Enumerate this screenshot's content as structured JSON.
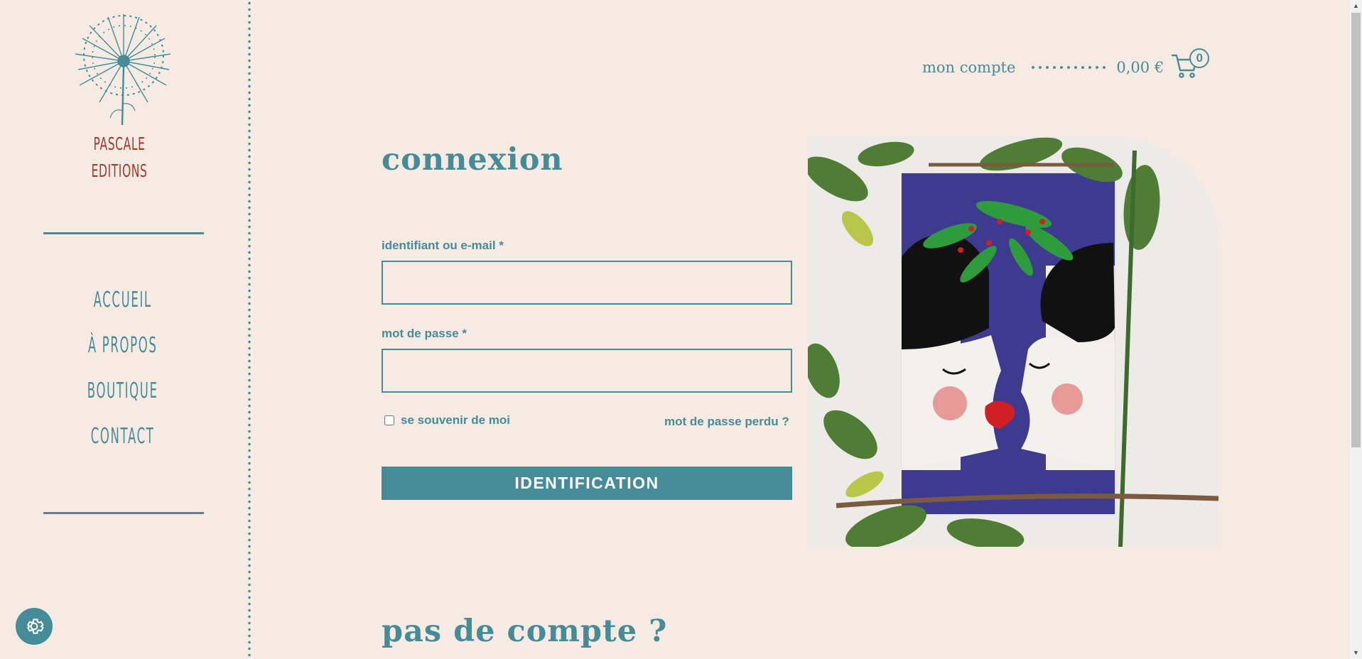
{
  "brand": {
    "line1": "PASCALE",
    "line2": "EDITIONS"
  },
  "nav": {
    "items": [
      {
        "label": "ACCUEIL"
      },
      {
        "label": "À PROPOS"
      },
      {
        "label": "BOUTIQUE"
      },
      {
        "label": "CONTACT"
      }
    ]
  },
  "header": {
    "account_label": "mon compte",
    "cart_total": "0,00 €",
    "cart_count": "0"
  },
  "login": {
    "title": "connexion",
    "username_label": "identifiant ou e-mail *",
    "username_value": "",
    "password_label": "mot de passe *",
    "password_value": "",
    "remember_label": "se souvenir de moi",
    "remember_checked": false,
    "lost_password_label": "mot de passe perdu ?",
    "submit_label": "IDENTIFICATION"
  },
  "register": {
    "title": "pas de compte ?"
  },
  "icons": {
    "logo": "dandelion-logo-icon",
    "cart": "shopping-cart-icon",
    "settings": "gear-icon"
  },
  "colors": {
    "background": "#f5ebe3",
    "accent": "#468c98",
    "brand": "#a33a2b"
  }
}
